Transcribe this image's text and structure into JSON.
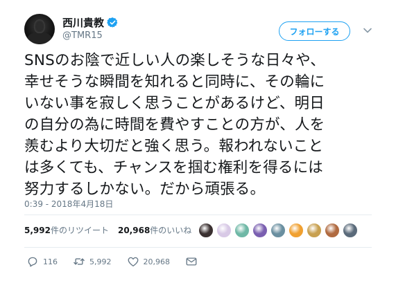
{
  "author": {
    "display_name": "西川貴教",
    "handle": "@TMR15"
  },
  "follow_button": {
    "label": "フォローする"
  },
  "tweet": {
    "text": "SNSのお陰で近しい人の楽しそうな日々や、\n幸せそうな瞬間を知れると同時に、その輪に\nいない事を寂しく思うことがあるけど、明日\nの自分の為に時間を費やすことの方が、人を\n羨むより大切だと強く思う。報われないこと\nは多くても、チャンスを掴む権利を得るには\n努力するしかない。だから頑張る。",
    "timestamp": "0:39 - 2018年4月18日"
  },
  "stats": {
    "retweet_count": "5,992",
    "retweet_label": "件のリツイート",
    "like_count": "20,968",
    "like_label": "件のいいね"
  },
  "actions": {
    "reply_count": "116",
    "retweet_count": "5,992",
    "like_count": "20,968"
  },
  "icons": {
    "verified": "verified-badge-icon",
    "menu": "chevron-down-icon",
    "reply": "reply-icon",
    "retweet": "retweet-icon",
    "like": "heart-icon",
    "dm": "envelope-icon"
  },
  "colors": {
    "accent": "#1da1f2",
    "text": "#14171a",
    "muted": "#657786",
    "divider": "#e6ecf0"
  },
  "likers": [
    {
      "color": "#3a3030"
    },
    {
      "color": "#d8c9e6"
    },
    {
      "color": "#6fb8a6"
    },
    {
      "color": "#7a5fb0"
    },
    {
      "color": "#6a8fa0"
    },
    {
      "color": "#f0a030"
    },
    {
      "color": "#c8a050"
    },
    {
      "color": "#b06a40"
    },
    {
      "color": "#5a6a7a"
    }
  ]
}
